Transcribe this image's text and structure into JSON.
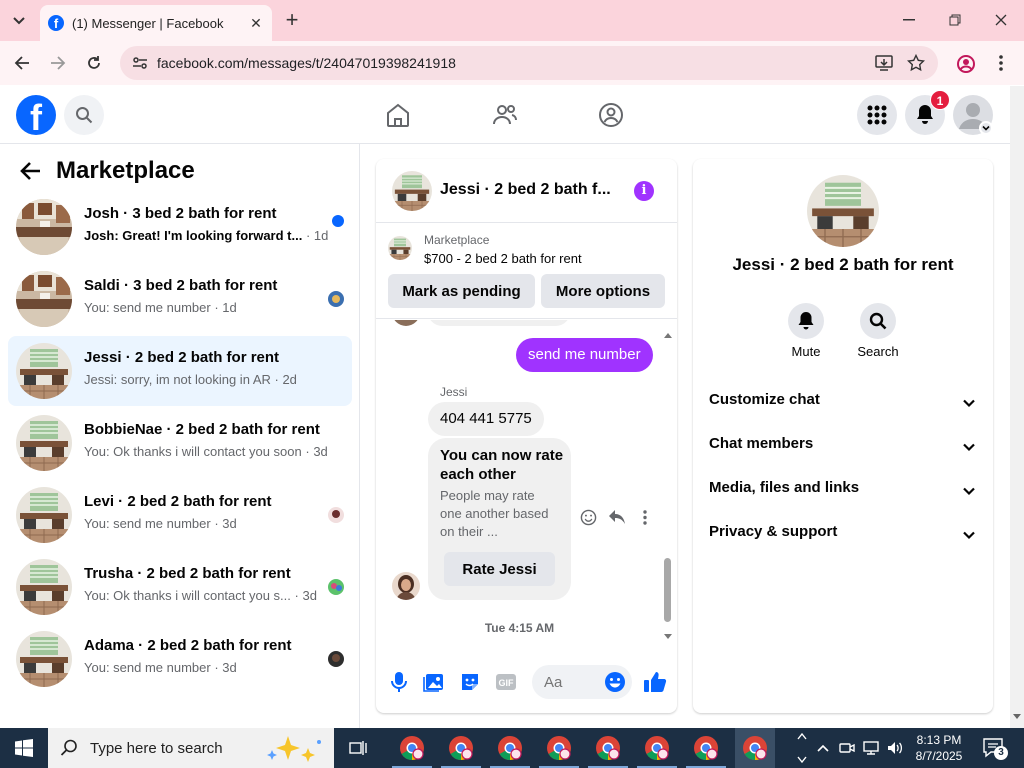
{
  "browser": {
    "tab_title": "(1) Messenger | Facebook",
    "url": "facebook.com/messages/t/24047019398241918"
  },
  "header": {
    "notification_count": "1"
  },
  "left_panel": {
    "title": "Marketplace",
    "conversations": [
      {
        "name": "Josh · 3 bed 2 bath for rent",
        "preview": "Josh: Great! I'm looking forward t...",
        "time": "1d",
        "unread": true,
        "avatar": "kitchen"
      },
      {
        "name": "Saldi · 3 bed 2 bath for rent",
        "preview": "You: send me number",
        "time": "1d",
        "unread": false,
        "avatar": "kitchen"
      },
      {
        "name": "Jessi · 2 bed 2 bath for rent",
        "preview": "Jessi: sorry, im not looking in AR",
        "time": "2d",
        "unread": false,
        "avatar": "room",
        "active": true
      },
      {
        "name": "BobbieNae · 2 bed 2 bath for rent",
        "preview": "You: Ok thanks i will contact you soon",
        "time": "3d",
        "unread": false,
        "avatar": "room"
      },
      {
        "name": "Levi · 2 bed 2 bath for rent",
        "preview": "You: send me number",
        "time": "3d",
        "unread": false,
        "avatar": "room"
      },
      {
        "name": "Trusha · 2 bed 2 bath for rent",
        "preview": "You: Ok thanks i will contact you s...",
        "time": "3d",
        "unread": false,
        "avatar": "room"
      },
      {
        "name": "Adama · 2 bed 2 bath for rent",
        "preview": "You: send me number",
        "time": "3d",
        "unread": false,
        "avatar": "room"
      }
    ]
  },
  "chat": {
    "title": "Jessi · 2 bed 2 bath f...",
    "listing_category": "Marketplace",
    "listing_price": "$700 - 2 bed 2 bath for rent",
    "mark_pending_label": "Mark as pending",
    "more_options_label": "More options",
    "outgoing_message": "send me number",
    "sender_name": "Jessi",
    "incoming_message": "404 441 5775",
    "rate_heading": "You can now rate each other",
    "rate_body": "People may rate one another based on their ...",
    "rate_button": "Rate Jessi",
    "timestamp": "Tue 4:15 AM",
    "input_placeholder": "Aa"
  },
  "info": {
    "name": "Jessi · 2 bed 2 bath for rent",
    "mute_label": "Mute",
    "search_label": "Search",
    "sections": [
      "Customize chat",
      "Chat members",
      "Media, files and links",
      "Privacy & support"
    ]
  },
  "taskbar": {
    "search_placeholder": "Type here to search",
    "time": "8:13 PM",
    "date": "8/7/2025",
    "notification_count": "3"
  },
  "colors": {
    "accent": "#a033ff",
    "fb_blue": "#0866ff",
    "active_row": "#ebf5ff",
    "taskbar": "#1c2f44"
  }
}
